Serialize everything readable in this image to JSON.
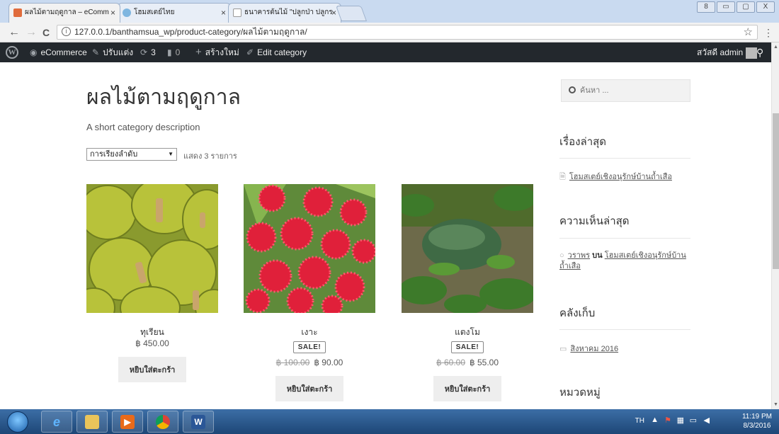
{
  "browser": {
    "tabs": [
      {
        "label": "ผลไม้ตามฤดูกาล – eComm",
        "favicon_color": "#e06c3c"
      },
      {
        "label": "โฮมสเตย์ไทย",
        "favicon_color": "#7fb6e0"
      },
      {
        "label": "ธนาคารต้นไม้ \"ปลูกป่า ปลูกร",
        "favicon_color": "#ffffff"
      }
    ],
    "url": "127.0.0.1/banthamsua_wp/product-category/ผลไม้ตามฤดูกาล/",
    "nav": {
      "back": "←",
      "forward": "→",
      "reload": "C"
    },
    "star": "☆",
    "menu": "⋮",
    "window_controls": [
      "8",
      "▭",
      "▢",
      "X"
    ]
  },
  "adminbar": {
    "wp_logo": "W",
    "site": "eCommerce",
    "customize": "ปรับแต่ง",
    "updates": "3",
    "comments": "0",
    "new": "สร้างใหม่",
    "edit": "Edit category",
    "greeting": "สวัสดี admin",
    "search_icon": "search-icon"
  },
  "page": {
    "title": "ผลไม้ตามฤดูกาล",
    "description": "A short category description",
    "orderby": "การเรียงลำดับ",
    "result_count": "แสดง 3 รายการ",
    "add_to_cart": "หยิบใส่ตะกร้า",
    "sale_label": "SALE!"
  },
  "products": [
    {
      "name": "ทุเรียน",
      "price": "฿ 450.00",
      "regular_price": "",
      "on_sale": false
    },
    {
      "name": "เงาะ",
      "price": "฿ 90.00",
      "regular_price": "฿ 100.00",
      "on_sale": true
    },
    {
      "name": "แตงโม",
      "price": "฿ 55.00",
      "regular_price": "฿ 60.00",
      "on_sale": true
    }
  ],
  "sidebar": {
    "search_placeholder": "ค้นหา ...",
    "recent_posts_title": "เรื่องล่าสุด",
    "recent_post": "โฮมสเตย์เชิงอนุรักษ์บ้านถ้ำเสือ",
    "recent_comments_title": "ความเห็นล่าสุด",
    "comment_author": "วราพร",
    "comment_on": "บน",
    "comment_post": "โฮมสเตย์เชิงอนุรักษ์บ้านถ้ำเสือ",
    "archives_title": "คลังเก็บ",
    "archive_item": "สิงหาคม 2016",
    "categories_title": "หมวดหมู่"
  },
  "taskbar": {
    "lang": "TH",
    "time": "11:19 PM",
    "date": "8/3/2016"
  }
}
